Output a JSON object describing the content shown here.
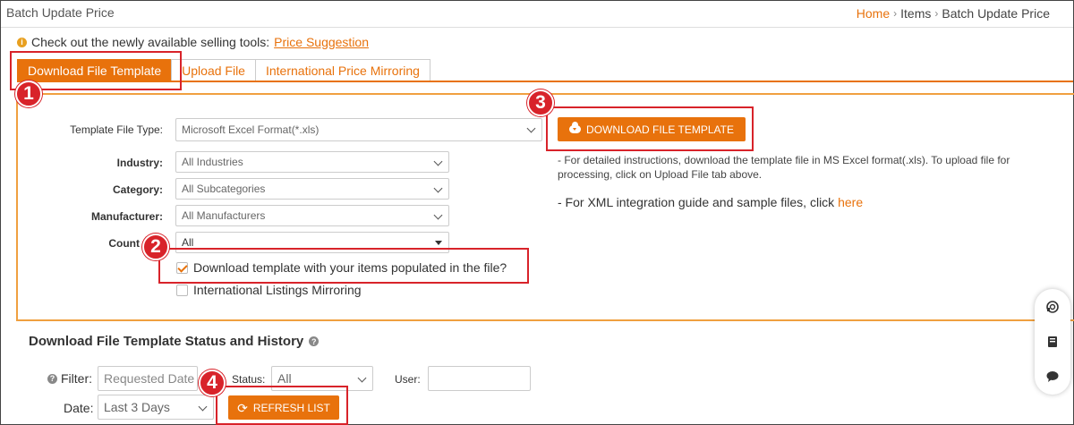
{
  "header": {
    "title": "Batch Update Price",
    "breadcrumb": [
      {
        "label": "Home"
      },
      {
        "label": "Items"
      },
      {
        "label": "Batch Update Price"
      }
    ]
  },
  "notice": {
    "text": "Check out the newly available selling tools:",
    "link": "Price Suggestion"
  },
  "tabs": [
    {
      "label": "Download File Template",
      "active": true
    },
    {
      "label": "Upload File",
      "active": false
    },
    {
      "label": "International Price Mirroring",
      "active": false
    }
  ],
  "form": {
    "template_type": {
      "label": "Template File Type:",
      "value": "Microsoft Excel Format(*.xls)"
    },
    "industry": {
      "label": "Industry:",
      "value": "All Industries"
    },
    "category": {
      "label": "Category:",
      "value": "All Subcategories"
    },
    "manufacturer": {
      "label": "Manufacturer:",
      "value": "All Manufacturers"
    },
    "country": {
      "label": "Count",
      "value": "All"
    },
    "populate_checkbox": {
      "label": "Download template with your items populated in the file?",
      "checked": true
    },
    "mirroring_checkbox": {
      "label": "International Listings Mirroring",
      "checked": false
    }
  },
  "download_button": "DOWNLOAD FILE TEMPLATE",
  "notes": {
    "instructions": "- For detailed instructions, download the template file in MS Excel format(.xls). To upload file for processing, click on Upload File tab above.",
    "xml_text": "- For XML integration guide and sample files, click",
    "xml_link": "here"
  },
  "history": {
    "title": "Download File Template Status and History",
    "filter_label": "Filter:",
    "filter_value": "Requested Date",
    "status_label": "Status:",
    "status_value": "All",
    "user_label": "User:",
    "user_value": "",
    "date_label": "Date:",
    "date_value": "Last 3 Days",
    "refresh_button": "REFRESH LIST"
  },
  "callouts": [
    "1",
    "2",
    "3",
    "4"
  ],
  "colors": {
    "accent": "#e8720c",
    "callout": "#d8232a",
    "panel_border": "#f0a040"
  },
  "side_icons": [
    "support-icon",
    "book-icon",
    "chat-icon"
  ]
}
